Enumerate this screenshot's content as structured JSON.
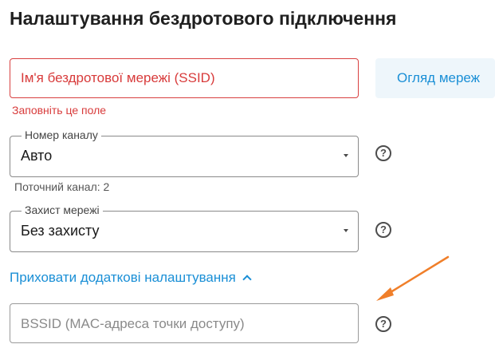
{
  "page": {
    "title": "Налаштування бездротового підключення"
  },
  "ssid": {
    "placeholder": "Ім'я бездротової мережі (SSID)",
    "error": "Заповніть це поле"
  },
  "scan_button": {
    "label": "Огляд мереж"
  },
  "channel": {
    "label": "Номер каналу",
    "value": "Авто",
    "current": "Поточний канал: 2"
  },
  "security": {
    "label": "Захист мережі",
    "value": "Без захисту"
  },
  "advanced": {
    "toggle_label": "Приховати додаткові налаштування"
  },
  "bssid": {
    "placeholder": "BSSID (MAC-адреса точки доступу)"
  },
  "help": {
    "glyph": "?"
  },
  "colors": {
    "accent": "#1a8fd6",
    "error": "#d83b3b",
    "annotation_arrow": "#f07f2a"
  },
  "icons": {
    "help": "question-circle-icon",
    "dropdown": "caret-down-icon",
    "collapse": "chevron-up-icon",
    "annotation": "arrow-annotation-icon"
  }
}
